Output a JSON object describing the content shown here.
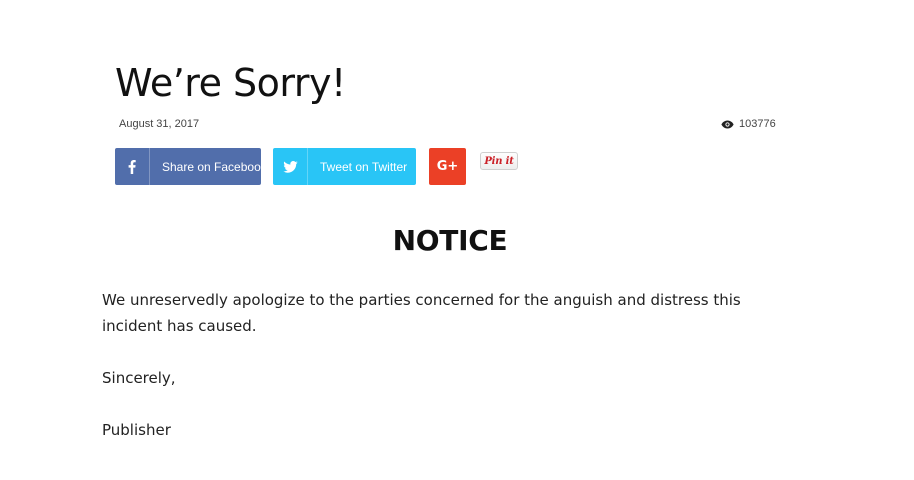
{
  "post": {
    "title": "We’re Sorry!",
    "date": "August 31, 2017",
    "views": "103776"
  },
  "share": {
    "facebook_label": "Share on Facebook",
    "twitter_label": "Tweet on Twitter",
    "google_label": "G+",
    "pinterest_label": "Pin it",
    "facebook_color": "#516eab",
    "twitter_color": "#29c5f6",
    "google_color": "#eb4026"
  },
  "body": {
    "heading": "NOTICE",
    "paragraph": "We unreservedly apologize to the parties concerned for the anguish and distress this incident has caused.",
    "closing": "Sincerely,",
    "signature": "Publisher"
  }
}
